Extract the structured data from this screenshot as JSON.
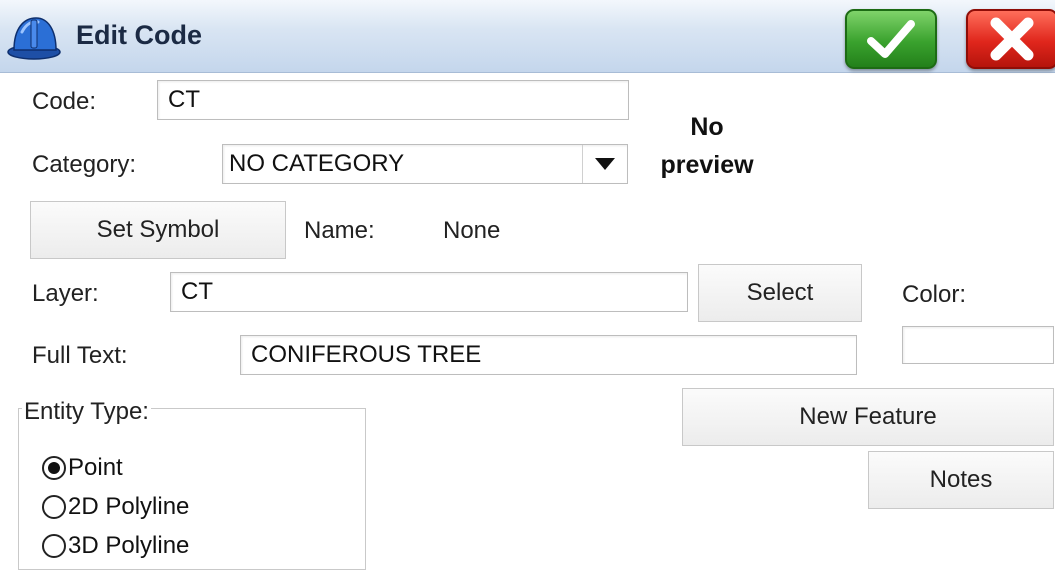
{
  "window": {
    "title": "Edit Code",
    "icon": "hard-hat-icon"
  },
  "toolbar": {
    "ok_icon": "checkmark-icon",
    "cancel_icon": "close-x-icon"
  },
  "form": {
    "code_label": "Code:",
    "code_value": "CT",
    "category_label": "Category:",
    "category_value": "NO CATEGORY",
    "preview_line1": "No",
    "preview_line2": "preview",
    "set_symbol_label": "Set Symbol",
    "name_label": "Name:",
    "name_value": "None",
    "layer_label": "Layer:",
    "layer_value": "CT",
    "select_label": "Select",
    "color_label": "Color:",
    "full_text_label": "Full Text:",
    "full_text_value": "CONIFEROUS TREE",
    "new_feature_label": "New Feature",
    "notes_label": "Notes"
  },
  "entity_type": {
    "title": "Entity Type:",
    "options": [
      "Point",
      "2D Polyline",
      "3D Polyline"
    ],
    "selected": "Point"
  },
  "colors": {
    "ok": "#3aa22e",
    "cancel": "#e0261c",
    "titlebar": "#c4d6ec"
  }
}
